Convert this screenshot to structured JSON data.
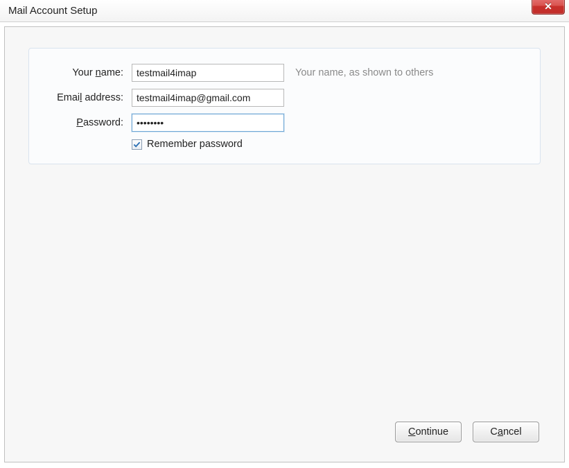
{
  "window": {
    "title": "Mail Account Setup"
  },
  "form": {
    "your_name_label_pre": "Your ",
    "your_name_label_ul": "n",
    "your_name_label_post": "ame:",
    "your_name_value": "testmail4imap",
    "your_name_hint": "Your name, as shown to others",
    "email_label_pre": "Emai",
    "email_label_ul": "l",
    "email_label_post": " address:",
    "email_value": "testmail4imap@gmail.com",
    "password_label_ul": "P",
    "password_label_post": "assword:",
    "password_value": "••••••••",
    "remember_pre": "Re",
    "remember_ul": "m",
    "remember_post": "ember password",
    "remember_checked": true
  },
  "buttons": {
    "continue_ul": "C",
    "continue_post": "ontinue",
    "cancel_pre": "C",
    "cancel_ul": "a",
    "cancel_post": "ncel"
  }
}
